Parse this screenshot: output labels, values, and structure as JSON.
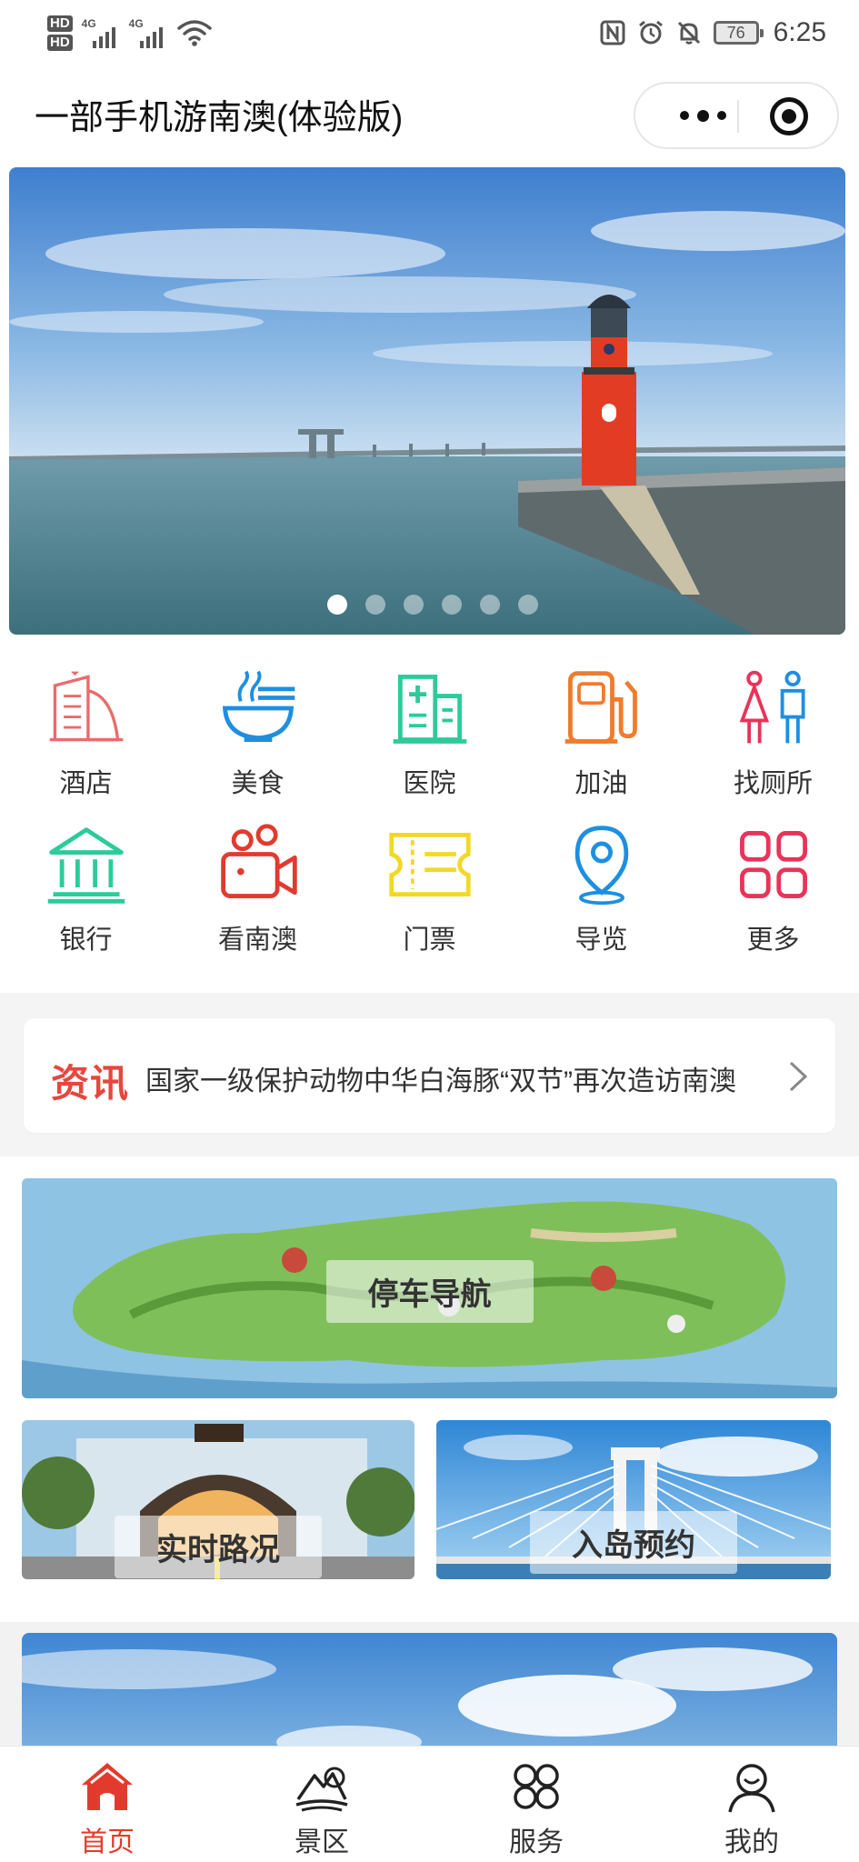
{
  "status_bar": {
    "hd1": "HD",
    "hd2": "HD",
    "net1": "4G",
    "net2": "4G",
    "battery": "76",
    "time": "6:25"
  },
  "nav": {
    "title": "一部手机游南澳(体验版)"
  },
  "banner": {
    "slides": 6,
    "active_index": 0
  },
  "grid": [
    {
      "label": "酒店",
      "icon": "hotel-icon",
      "color": "#ea6b6b"
    },
    {
      "label": "美食",
      "icon": "noodle-bowl-icon",
      "color": "#1e8fe0"
    },
    {
      "label": "医院",
      "icon": "hospital-icon",
      "color": "#2ccb9a"
    },
    {
      "label": "加油",
      "icon": "gas-pump-icon",
      "color": "#f07b2d"
    },
    {
      "label": "找厕所",
      "icon": "restroom-icon",
      "color": "#e8345a"
    },
    {
      "label": "银行",
      "icon": "bank-icon",
      "color": "#2ccb9a"
    },
    {
      "label": "看南澳",
      "icon": "video-camera-icon",
      "color": "#e03b30"
    },
    {
      "label": "门票",
      "icon": "ticket-icon",
      "color": "#f2d826"
    },
    {
      "label": "导览",
      "icon": "location-pin-icon",
      "color": "#1e8fe0"
    },
    {
      "label": "更多",
      "icon": "grid-more-icon",
      "color": "#e8345a"
    }
  ],
  "news": {
    "tag": "资讯",
    "text": "国家一级保护动物中华白海豚“双节”再次造访南澳"
  },
  "cards": {
    "parking": "停车导航",
    "traffic": "实时路况",
    "booking": "入岛预约"
  },
  "tabs": [
    {
      "label": "首页",
      "icon": "home-icon",
      "active": true
    },
    {
      "label": "景区",
      "icon": "scenic-mountain-icon",
      "active": false
    },
    {
      "label": "服务",
      "icon": "services-icon",
      "active": false
    },
    {
      "label": "我的",
      "icon": "profile-icon",
      "active": false
    }
  ],
  "colors": {
    "accent": "#e23b2e",
    "news_tag": "#e6473f"
  }
}
